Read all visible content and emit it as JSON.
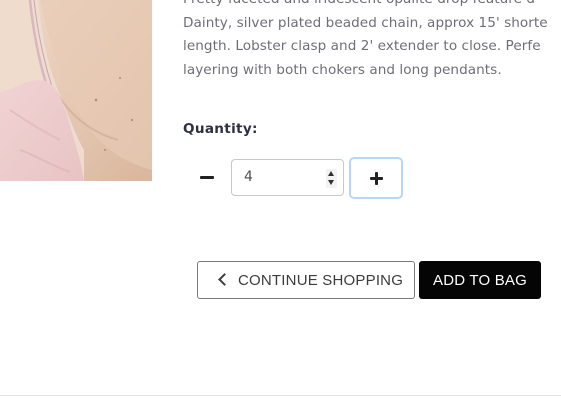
{
  "product": {
    "description_lines": [
      "Pretty faceted and iridescent opalite drop feature d",
      "Dainty, silver plated beaded chain, approx 15' shorte",
      "length. Lobster clasp and 2' extender to close. Perfe",
      "layering with both chokers and long pendants."
    ]
  },
  "quantity": {
    "label": "Quantity:",
    "value": "4",
    "decrement_icon": "minus-icon",
    "increment_icon": "plus-icon"
  },
  "actions": {
    "continue_label": "CONTINUE SHOPPING",
    "continue_icon": "chevron-left-icon",
    "add_to_bag_label": "ADD TO BAG"
  },
  "colors": {
    "accent_focus": "#b9d6f5",
    "primary_button": "#050505",
    "text_muted": "#6e6e78"
  }
}
